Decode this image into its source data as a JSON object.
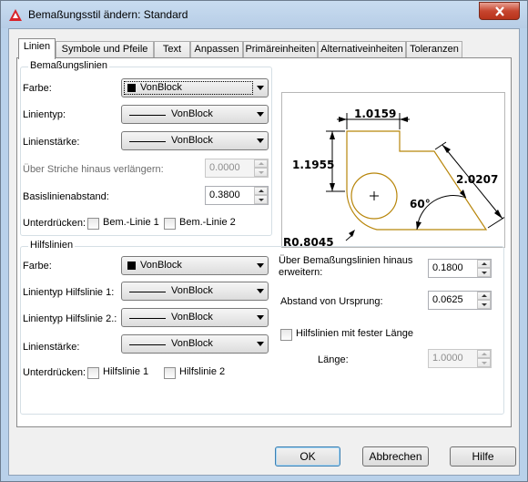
{
  "window": {
    "title": "Bemaßungsstil ändern: Standard"
  },
  "tabs": [
    {
      "label": "Linien"
    },
    {
      "label": "Symbole und Pfeile"
    },
    {
      "label": "Text"
    },
    {
      "label": "Anpassen"
    },
    {
      "label": "Primäreinheiten"
    },
    {
      "label": "Alternativeinheiten"
    },
    {
      "label": "Toleranzen"
    }
  ],
  "dim_lines": {
    "group_title": "Bemaßungslinien",
    "color_label": "Farbe:",
    "color_value": "VonBlock",
    "linetype_label": "Linientyp:",
    "linetype_value": "VonBlock",
    "lineweight_label": "Linienstärke:",
    "lineweight_value": "VonBlock",
    "extend_label": "Über Striche hinaus verlängern:",
    "extend_value": "0.0000",
    "baseline_label": "Basislinienabstand:",
    "baseline_value": "0.3800",
    "suppress_label": "Unterdrücken:",
    "suppress_line1": "Bem.-Linie 1",
    "suppress_line2": "Bem.-Linie 2"
  },
  "preview": {
    "dim_top": "1.0159",
    "dim_left": "1.1955",
    "dim_right": "2.0207",
    "angle": "60°",
    "radius": "R0.8045"
  },
  "ext_lines": {
    "group_title": "Hilfslinien",
    "color_label": "Farbe:",
    "color_value": "VonBlock",
    "linetype1_label": "Linientyp Hilfslinie 1:",
    "linetype1_value": "VonBlock",
    "linetype2_label": "Linientyp Hilfslinie 2.:",
    "linetype2_value": "VonBlock",
    "lineweight_label": "Linienstärke:",
    "lineweight_value": "VonBlock",
    "suppress_label": "Unterdrücken:",
    "suppress_ext1": "Hilfslinie 1",
    "suppress_ext2": "Hilfslinie 2",
    "extend_beyond_label": "Über Bemaßungslinien hinaus erweitern:",
    "extend_beyond_value": "0.1800",
    "offset_label": "Abstand von Ursprung:",
    "offset_value": "0.0625",
    "fixed_length_label": "Hilfslinien mit fester Länge",
    "length_label": "Länge:",
    "length_value": "1.0000"
  },
  "buttons": {
    "ok": "OK",
    "cancel": "Abbrechen",
    "help": "Hilfe"
  },
  "colors": {
    "preview_outline": "#b8860b",
    "title_bar": "#b9d1ea",
    "close_button": "#c7462f"
  }
}
